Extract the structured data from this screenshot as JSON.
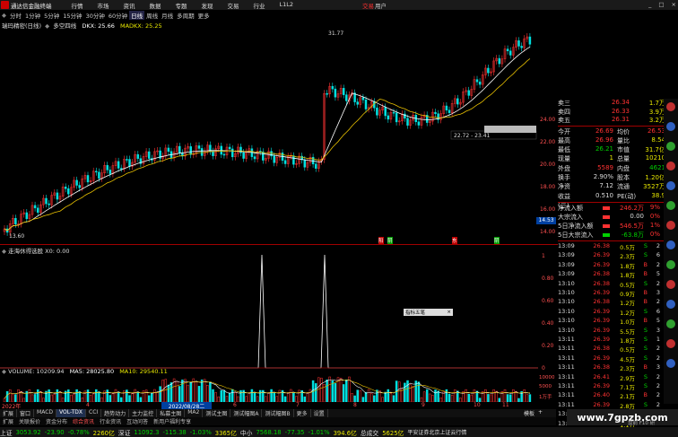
{
  "app": {
    "title": "通达信金融终端",
    "menu": [
      "行情",
      "市场",
      "资讯",
      "数据",
      "专题",
      "发现",
      "交易",
      "行业",
      "L1L2"
    ],
    "trade_label": "交易",
    "trade_suffix": "用户"
  },
  "periods": [
    "分时",
    "1分钟",
    "5分钟",
    "15分钟",
    "30分钟",
    "60分钟",
    "日线",
    "周线",
    "月线",
    "多周期",
    "更多"
  ],
  "active_period": "日线",
  "main_chart": {
    "header": "瑞玛精密(日线)",
    "indicator_name": "多空四线",
    "dkx_label": "DKX: 25.66",
    "madkx_label": "MADKX: 25.25",
    "high_label": "31.77",
    "low_label": "13.60",
    "range_label": "22.72 - 23.41",
    "price_ticks": [
      "24.00",
      "22.00",
      "20.00",
      "18.00",
      "16.00",
      "14.00"
    ],
    "current_price_tag": "14.53",
    "markers": [
      "阳",
      "阴",
      "东",
      "阴"
    ]
  },
  "sub_chart1": {
    "header": "走海休得选股  X0: 0.00",
    "ticks": [
      "1",
      "0.80",
      "0.60",
      "0.40",
      "0.20",
      "0"
    ],
    "popup": "指标五笔"
  },
  "volume_chart": {
    "header_name": "VOLUME: 10209.94",
    "ma5": "MA5: 28025.80",
    "ma10": "MA10: 29540.11",
    "ticks": [
      "10000",
      "5000",
      "1万手"
    ],
    "date_label": "2022/08/28二",
    "x_labels": [
      "2022年",
      "4",
      "5",
      "6",
      "7",
      "8",
      "9",
      "10",
      "11"
    ]
  },
  "quote": {
    "sell_rows": [
      {
        "label": "卖三",
        "price": "26.34",
        "vol": "1.7万"
      },
      {
        "label": "卖四",
        "price": "26.33",
        "vol": "3.9万"
      },
      {
        "label": "卖五",
        "price": "26.31",
        "vol": "3.2万"
      }
    ],
    "stats": [
      {
        "l1": "今开",
        "v1": "26.69",
        "l2": "均价",
        "v2": "26.53"
      },
      {
        "l1": "最高",
        "v1": "26.96",
        "l2": "量比",
        "v2": "8.54"
      },
      {
        "l1": "最低",
        "v1": "26.21",
        "l2": "市值",
        "v2": "31.7亿"
      },
      {
        "l1": "现量",
        "v1": "1",
        "l2": "总量",
        "v2": "10210"
      },
      {
        "l1": "外盘",
        "v1": "5589",
        "l2": "内盘",
        "v2": "4621"
      },
      {
        "l1": "换手",
        "v1": "2.90%",
        "l2": "股本",
        "v2": "1.20亿"
      },
      {
        "l1": "净资",
        "v1": "7.12",
        "l2": "流通",
        "v2": "3527万"
      },
      {
        "l1": "收益(三)",
        "v1": "0.510",
        "l2": "PE(动)",
        "v2": "38.9"
      }
    ],
    "flows": [
      {
        "label": "净流入额",
        "value": "246.2万",
        "pct": "9%"
      },
      {
        "label": "大宗流入",
        "value": "0.00",
        "pct": "0%"
      },
      {
        "label": "5日净流入额",
        "value": "546.5万",
        "pct": "1%"
      },
      {
        "label": "5日大宗流入",
        "value": "-63.8万",
        "pct": "0%"
      }
    ],
    "ticks": [
      {
        "t": "13:09",
        "p": "26.38",
        "v": "0.5万",
        "d": "S",
        "n": "2"
      },
      {
        "t": "13:09",
        "p": "26.39",
        "v": "2.3万",
        "d": "S",
        "n": "6"
      },
      {
        "t": "13:09",
        "p": "26.39",
        "v": "1.8万",
        "d": "B",
        "n": "2"
      },
      {
        "t": "13:09",
        "p": "26.38",
        "v": "1.8万",
        "d": "B",
        "n": "5"
      },
      {
        "t": "13:10",
        "p": "26.38",
        "v": "0.5万",
        "d": "S",
        "n": "2"
      },
      {
        "t": "13:10",
        "p": "26.39",
        "v": "0.9万",
        "d": "B",
        "n": "3"
      },
      {
        "t": "13:10",
        "p": "26.38",
        "v": "1.2万",
        "d": "B",
        "n": "2"
      },
      {
        "t": "13:10",
        "p": "26.39",
        "v": "1.2万",
        "d": "S",
        "n": "6"
      },
      {
        "t": "13:10",
        "p": "26.39",
        "v": "1.0万",
        "d": "B",
        "n": "5"
      },
      {
        "t": "13:10",
        "p": "26.39",
        "v": "5.5万",
        "d": "S",
        "n": "3"
      },
      {
        "t": "13:11",
        "p": "26.39",
        "v": "1.8万",
        "d": "S",
        "n": "1"
      },
      {
        "t": "13:11",
        "p": "26.38",
        "v": "0.5万",
        "d": "S",
        "n": "2"
      },
      {
        "t": "13:11",
        "p": "26.39",
        "v": "4.5万",
        "d": "S",
        "n": "2"
      },
      {
        "t": "13:11",
        "p": "26.38",
        "v": "2.3万",
        "d": "B",
        "n": "3"
      },
      {
        "t": "13:11",
        "p": "26.41",
        "v": "2.9万",
        "d": "S",
        "n": "2"
      },
      {
        "t": "13:11",
        "p": "26.39",
        "v": "7.1万",
        "d": "S",
        "n": "2"
      },
      {
        "t": "13:11",
        "p": "26.40",
        "v": "2.1万",
        "d": "B",
        "n": "2"
      },
      {
        "t": "13:11",
        "p": "26.39",
        "v": "2.8万",
        "d": "S",
        "n": "2"
      },
      {
        "t": "13:12",
        "p": "26.38",
        "v": "1.3万",
        "d": "S",
        "n": "2"
      },
      {
        "t": "13:12",
        "p": "26.39",
        "v": "1.1万",
        "d": "B",
        "n": "2"
      }
    ]
  },
  "tabs1": [
    "扩展",
    "窗口",
    "MACD",
    "VOL-TDX",
    "CCI",
    "趋势动力",
    "主力监控",
    "私募主图",
    "MA2",
    "测试主图",
    "测试幅图A",
    "测试幅图B",
    "更多",
    "设置"
  ],
  "active_tab": "VOL-TDX",
  "tabs2": [
    "扩展",
    "关联报价",
    "资金分布",
    "综合资讯",
    "行业资讯",
    "互动问答",
    "新用户福利专享"
  ],
  "side_tabs": [
    "模板",
    "+"
  ],
  "status": [
    {
      "name": "上证",
      "val": "3053.92",
      "chg": "-23.90",
      "pct": "-0.78%",
      "amt": "2260亿"
    },
    {
      "name": "深证",
      "val": "11092.3",
      "chg": "-115.38",
      "pct": "-1.03%",
      "amt": "3365亿"
    },
    {
      "name": "中小",
      "val": "7568.18",
      "chg": "-77.35",
      "pct": "-1.01%",
      "amt": "394.6亿"
    }
  ],
  "total_label": "总成交",
  "total_val": "5625亿",
  "broker": "平安证券北京上证云行情",
  "footer_note": "盘前 F10 研",
  "watermark": "www.7gpzb.com"
}
